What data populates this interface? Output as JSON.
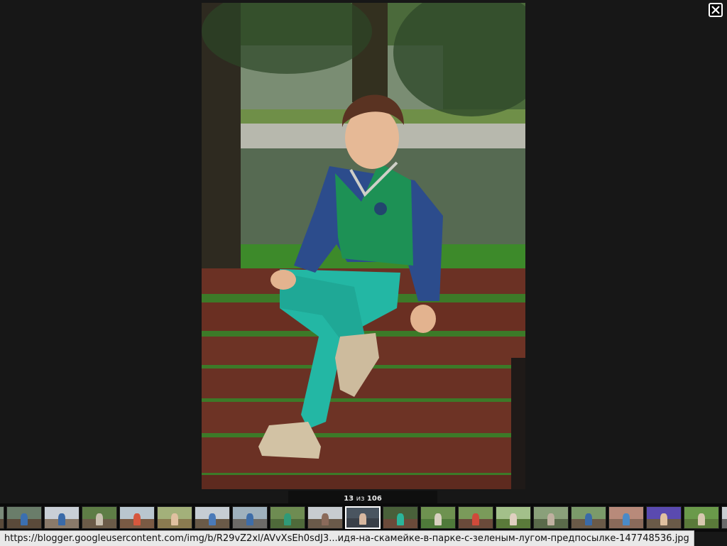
{
  "viewer": {
    "close_label": "✕",
    "counter": {
      "current": "13",
      "sep": "из",
      "total": "106"
    },
    "photo_alt": "boy sitting on a park bench"
  },
  "filmstrip": {
    "thumbs": [
      {
        "sky": "#6a7d6a",
        "ground": "#5a4a3a",
        "fig": "#3b6fb0"
      },
      {
        "sky": "#c9cfd6",
        "ground": "#8a7a6a",
        "fig": "#3a6aa8"
      },
      {
        "sky": "#5e7d46",
        "ground": "#6b5b48",
        "fig": "#c9c0b0"
      },
      {
        "sky": "#b9c6cf",
        "ground": "#7a5a44",
        "fig": "#d6573d"
      },
      {
        "sky": "#a3b07a",
        "ground": "#8a7a50",
        "fig": "#e0c0a0"
      },
      {
        "sky": "#c6cdd3",
        "ground": "#6a5a48",
        "fig": "#4a7ab8"
      },
      {
        "sky": "#9fb1bd",
        "ground": "#6d6b68",
        "fig": "#3e6da8"
      },
      {
        "sky": "#6e8c52",
        "ground": "#4f6a3a",
        "fig": "#2f9a78"
      },
      {
        "sky": "#c8ccd0",
        "ground": "#6a5a4a",
        "fig": "#8a6a5a"
      },
      {
        "sky": "#4a5560",
        "ground": "#3a4048",
        "fig": "#d8b8a0"
      },
      {
        "sky": "#49603a",
        "ground": "#6b4a3a",
        "fig": "#2bb59a"
      },
      {
        "sky": "#6e9250",
        "ground": "#4f7a3a",
        "fig": "#d8d0c0"
      },
      {
        "sky": "#7a9a5a",
        "ground": "#6a4a3a",
        "fig": "#d04a3a"
      },
      {
        "sky": "#a3c08a",
        "ground": "#5a7a3a",
        "fig": "#e0d0c0"
      },
      {
        "sky": "#8aa07a",
        "ground": "#5a6a4a",
        "fig": "#c0b0a0"
      },
      {
        "sky": "#7b9a6a",
        "ground": "#6a5a48",
        "fig": "#3a6aa8"
      },
      {
        "sky": "#b88a7a",
        "ground": "#8a6a5a",
        "fig": "#4a8ac8"
      },
      {
        "sky": "#5a4ab0",
        "ground": "#6a5a48",
        "fig": "#e0c0a0"
      },
      {
        "sky": "#6a9a4a",
        "ground": "#5a7a3a",
        "fig": "#d8c8b0"
      },
      {
        "sky": "#c8ccd0",
        "ground": "#6a6a6a",
        "fig": "#4a6a98"
      }
    ]
  },
  "statusbar": {
    "url": "https://blogger.googleusercontent.com/img/b/R29vZ2xl/AVvXsEh0sdJ3...идя-на-скамейке-в-парке-с-зеленым-лугом-предпосылке-147748536.jpg"
  }
}
